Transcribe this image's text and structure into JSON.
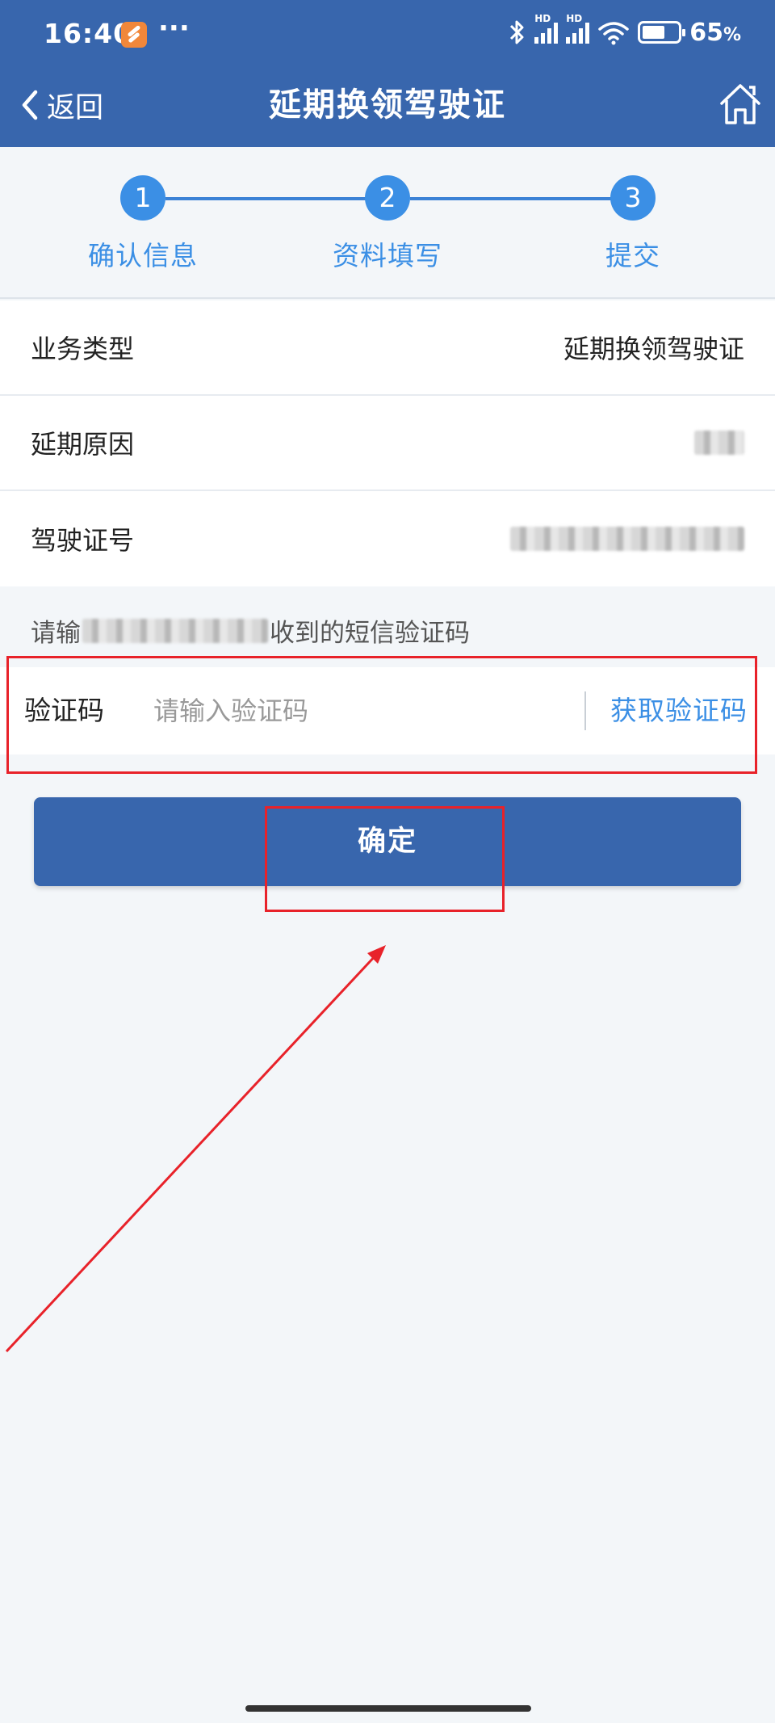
{
  "status_bar": {
    "time": "16:40",
    "more": "···",
    "hd_label": "HD",
    "battery_percent": "65",
    "battery_unit": "%",
    "battery_level": 0.65,
    "icons": [
      "app-notification-icon",
      "bluetooth-icon",
      "signal-icon",
      "signal-icon",
      "wifi-icon",
      "battery-icon"
    ]
  },
  "header": {
    "back_label": "返回",
    "title": "延期换领驾驶证",
    "home_icon": "home-icon",
    "background_color": "#3866ad"
  },
  "steps": [
    {
      "number": "1",
      "label": "确认信息"
    },
    {
      "number": "2",
      "label": "资料填写"
    },
    {
      "number": "3",
      "label": "提交"
    }
  ],
  "info_rows": [
    {
      "label": "业务类型",
      "value": "延期换领驾驶证"
    },
    {
      "label": "延期原因",
      "value": ""
    },
    {
      "label": "驾驶证号",
      "value": ""
    }
  ],
  "sms_hint": {
    "prefix": "请输",
    "suffix": "收到的短信验证码"
  },
  "code_field": {
    "label": "验证码",
    "placeholder": "请输入验证码",
    "value": "",
    "get_code_label": "获取验证码"
  },
  "confirm_button": {
    "label": "确定"
  },
  "colors": {
    "accent": "#3b8fe5",
    "primary": "#3866ad",
    "annotation_red": "#e8222a"
  }
}
